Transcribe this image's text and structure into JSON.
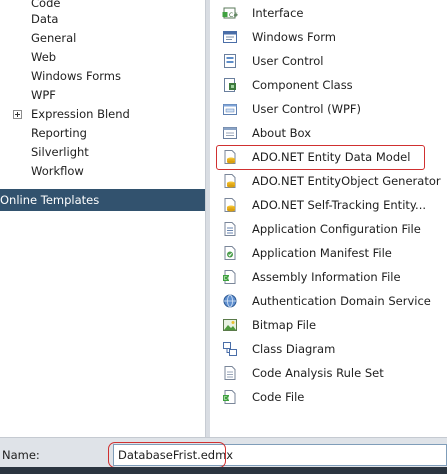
{
  "left_pane": {
    "items": [
      {
        "label": "Code"
      },
      {
        "label": "Data"
      },
      {
        "label": "General"
      },
      {
        "label": "Web"
      },
      {
        "label": "Windows Forms"
      },
      {
        "label": "WPF"
      },
      {
        "label": "Expression Blend"
      },
      {
        "label": "Reporting"
      },
      {
        "label": "Silverlight"
      },
      {
        "label": "Workflow"
      }
    ],
    "online_templates": "Online Templates"
  },
  "templates": [
    {
      "label": "Interface",
      "icon": "interface-icon"
    },
    {
      "label": "Windows Form",
      "icon": "windows-form-icon"
    },
    {
      "label": "User Control",
      "icon": "user-control-icon"
    },
    {
      "label": "Component Class",
      "icon": "component-class-icon"
    },
    {
      "label": "User Control (WPF)",
      "icon": "user-control-wpf-icon"
    },
    {
      "label": "About Box",
      "icon": "about-box-icon"
    },
    {
      "label": "ADO.NET Entity Data Model",
      "icon": "entity-data-model-icon",
      "selected": true
    },
    {
      "label": "ADO.NET EntityObject Generator",
      "icon": "entityobject-generator-icon"
    },
    {
      "label": "ADO.NET Self-Tracking Entity...",
      "icon": "self-tracking-entity-icon"
    },
    {
      "label": "Application Configuration File",
      "icon": "app-config-icon"
    },
    {
      "label": "Application Manifest File",
      "icon": "app-manifest-icon"
    },
    {
      "label": "Assembly Information File",
      "icon": "assembly-info-icon"
    },
    {
      "label": "Authentication Domain Service",
      "icon": "domain-service-icon"
    },
    {
      "label": "Bitmap File",
      "icon": "bitmap-icon"
    },
    {
      "label": "Class Diagram",
      "icon": "class-diagram-icon"
    },
    {
      "label": "Code Analysis Rule Set",
      "icon": "rule-set-icon"
    },
    {
      "label": "Code File",
      "icon": "code-file-icon"
    }
  ],
  "bottom": {
    "name_label": "Name:",
    "name_value": "DatabaseFrist.edmx"
  },
  "colors": {
    "selection_bg": "#32526e",
    "highlight_red": "#d03030"
  }
}
